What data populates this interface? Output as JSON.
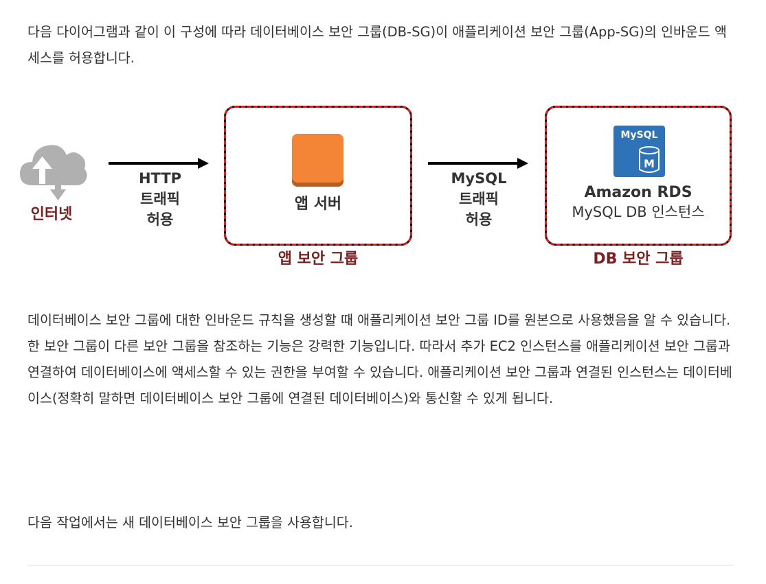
{
  "intro": "다음 다이어그램과 같이 이 구성에 따라 데이터베이스 보안 그룹(DB-SG)이 애플리케이션 보안 그룹(App-SG)의 인바운드 액세스를 허용합니다.",
  "diagram": {
    "internet_label": "인터넷",
    "http_traffic": [
      "HTTP",
      "트래픽",
      "허용"
    ],
    "app_server_label": "앱 서버",
    "app_sg_label": "앱 보안 그룹",
    "mysql_traffic": [
      "MySQL",
      "트래픽",
      "허용"
    ],
    "mysql_icon_text": "MySQL",
    "mysql_icon_letter": "M",
    "rds_title": "Amazon RDS",
    "rds_subtitle": "MySQL DB 인스턴스",
    "db_sg_label": "DB 보안 그룹",
    "colors": {
      "label_red": "#7b1f1f",
      "app_orange": "#f58536",
      "mysql_blue": "#2e73b8",
      "cloud_gray": "#b0b0b0",
      "border_red": "#e21c1c"
    }
  },
  "body_text": "데이터베이스 보안 그룹에 대한 인바운드 규칙을 생성할 때 애플리케이션 보안 그룹 ID를 원본으로 사용했음을 알 수 있습니다. 한 보안 그룹이 다른 보안 그룹을 참조하는 기능은 강력한 기능입니다. 따라서 추가 EC2 인스턴스를 애플리케이션 보안 그룹과 연결하여 데이터베이스에 액세스할 수 있는 권한을 부여할 수 있습니다. 애플리케이션 보안 그룹과 연결된 인스턴스는 데이터베이스(정확히 말하면 데이터베이스 보안 그룹에 연결된 데이터베이스)와 통신할 수 있게 됩니다.",
  "closing": "다음 작업에서는 새 데이터베이스 보안 그룹을 사용합니다."
}
